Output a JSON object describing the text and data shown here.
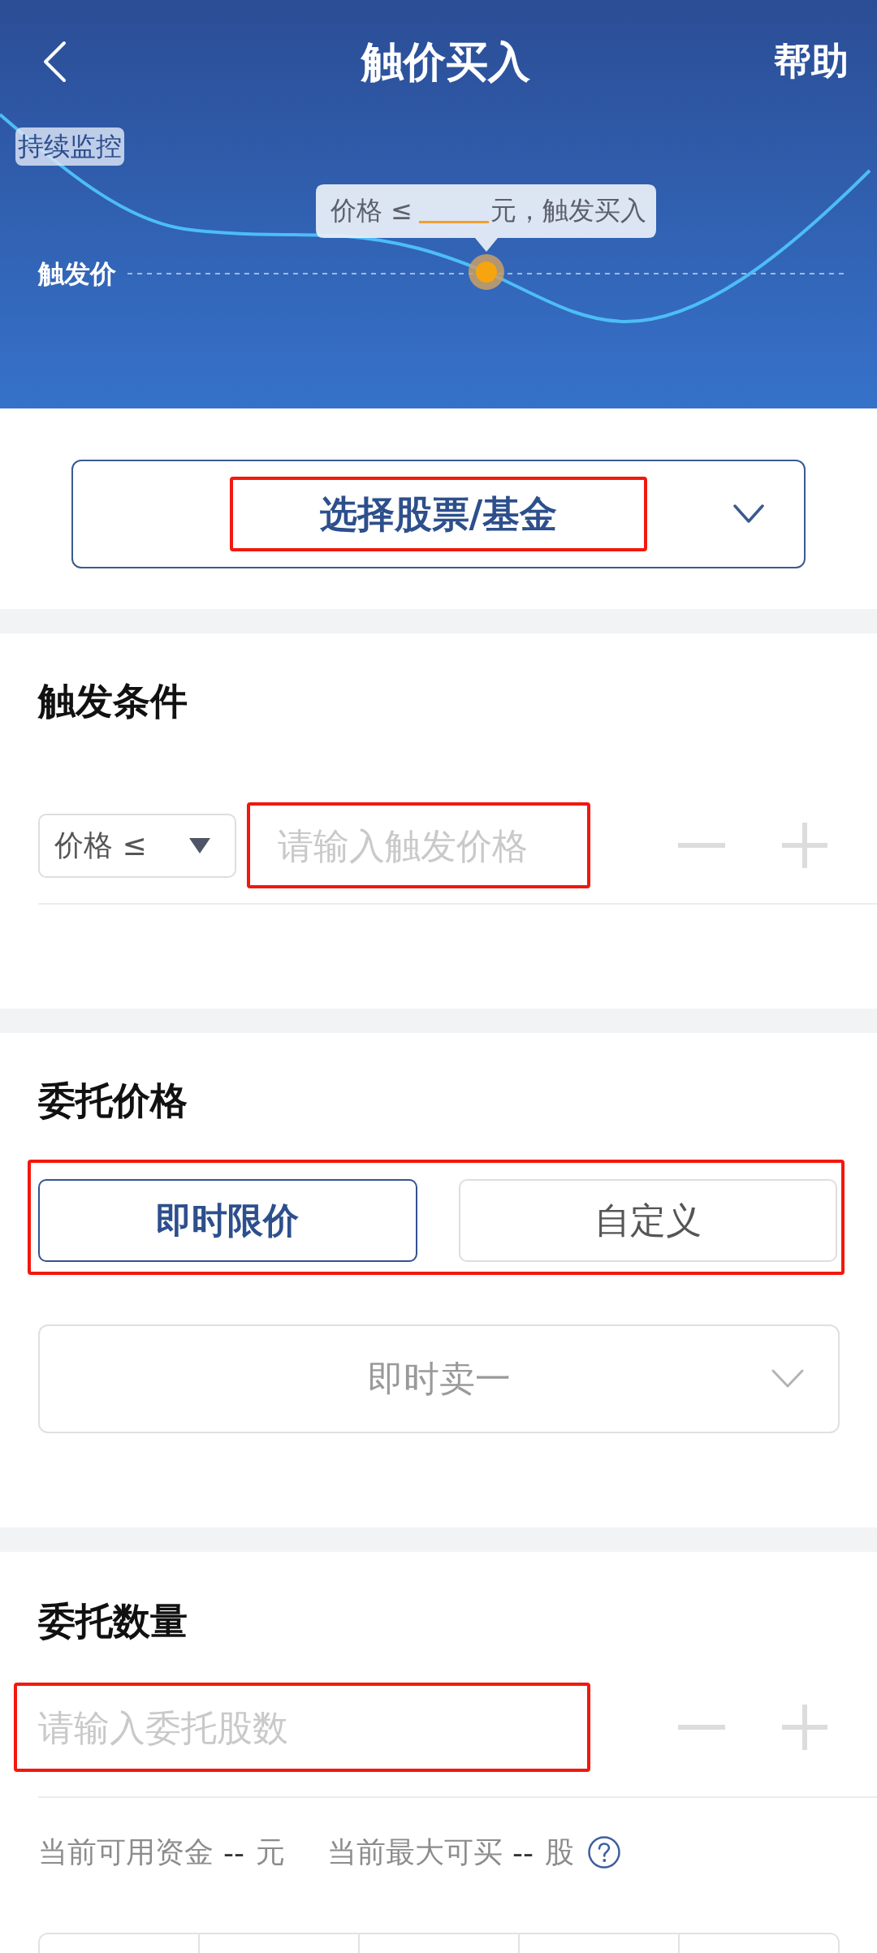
{
  "nav": {
    "title": "触价买入",
    "help": "帮助"
  },
  "chart": {
    "badge": "持续监控",
    "tooltip": {
      "prefix": "价格 ≤",
      "suffix": "元，触发买入"
    },
    "trigger_label": "触发价"
  },
  "stock_selector": {
    "label": "选择股票/基金",
    "highlighted": true
  },
  "trigger_condition": {
    "title": "触发条件",
    "operator": "价格 ≤",
    "price_input": {
      "placeholder": "请输入触发价格",
      "highlighted": true
    },
    "stepper_disabled": true
  },
  "order_price": {
    "title": "委托价格",
    "tabs": [
      {
        "label": "即时限价",
        "selected": true
      },
      {
        "label": "自定义",
        "selected": false
      }
    ],
    "tabs_highlighted": true,
    "price_option": {
      "value": "即时卖一",
      "disabled": true
    }
  },
  "order_quantity": {
    "title": "委托数量",
    "quantity_input": {
      "placeholder": "请输入委托股数",
      "highlighted": true
    },
    "stepper_disabled": true,
    "info": [
      {
        "label": "当前可用资金",
        "value": "--",
        "unit": "元"
      },
      {
        "label": "当前最大可买",
        "value": "--",
        "unit": "股"
      }
    ],
    "quick_options": [
      {
        "selected": false
      },
      {
        "selected": false
      },
      {
        "selected": false
      },
      {
        "selected": false
      },
      {
        "selected": false
      }
    ]
  }
}
